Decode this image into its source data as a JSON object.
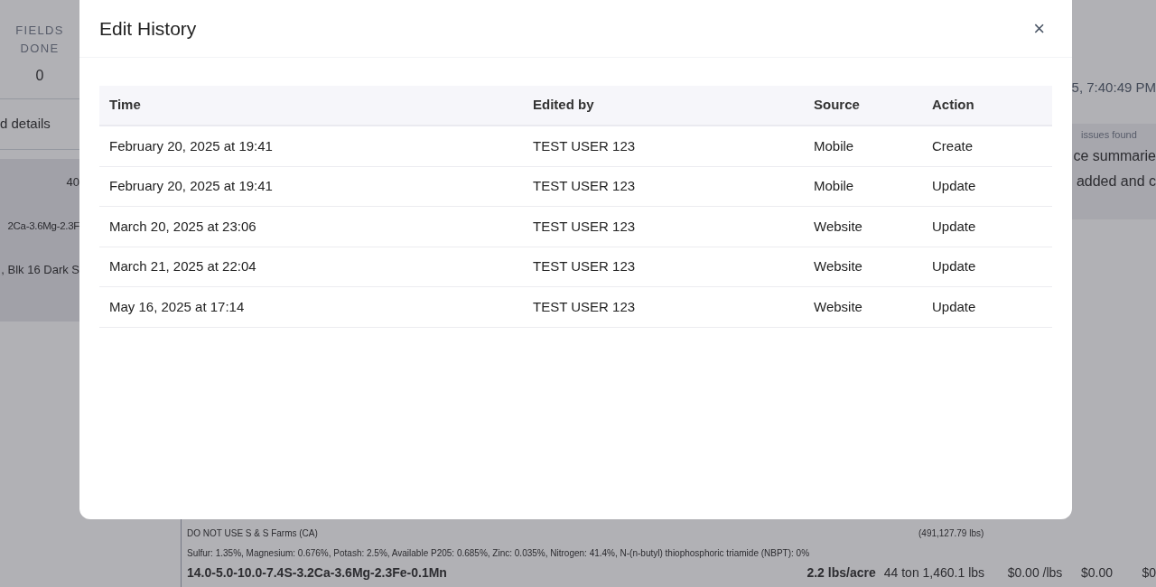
{
  "background": {
    "stat": {
      "label_lines": [
        "FIELDS",
        "DONE"
      ],
      "value": "0"
    },
    "details_link": "d details",
    "left_card": {
      "number": "40",
      "product": "2Ca-3.6Mg-2.3F",
      "location": ", Blk 16 Dark S"
    },
    "right_panel": {
      "timestamp": "5, 7:40:49 PM",
      "issues_label": "issues found",
      "lines": [
        "ce summarie",
        "added and c"
      ]
    },
    "product_row": {
      "source": "DO NOT USE S & S Farms (CA)",
      "total_lbs": "(491,127.79 lbs)",
      "composition": "Sulfur: 1.35%, Magnesium: 0.676%, Potash: 2.5%, Available P205: 0.685%, Zinc: 0.035%, Nitrogen: 41.4%, N-(n-butyl) thiophosphoric triamide (NBPT): 0%",
      "name": "14.0-5.0-10.0-7.4S-3.2Ca-3.6Mg-2.3Fe-0.1Mn",
      "rate": "2.2 lbs/acre",
      "amount": "44 ton 1,460.1 lbs",
      "unit_price": "$0.00 /lbs",
      "cost": "$0.00",
      "cut": "$0"
    }
  },
  "dialog": {
    "title": "Edit History",
    "close": "×",
    "columns": [
      "Time",
      "Edited by",
      "Source",
      "Action"
    ],
    "rows": [
      {
        "time": "February 20, 2025 at 19:41",
        "edited_by": "TEST USER 123",
        "source": "Mobile",
        "action": "Create"
      },
      {
        "time": "February 20, 2025 at 19:41",
        "edited_by": "TEST USER 123",
        "source": "Mobile",
        "action": "Update"
      },
      {
        "time": "March 20, 2025 at 23:06",
        "edited_by": "TEST USER 123",
        "source": "Website",
        "action": "Update"
      },
      {
        "time": "March 21, 2025 at 22:04",
        "edited_by": "TEST USER 123",
        "source": "Website",
        "action": "Update"
      },
      {
        "time": "May 16, 2025 at 17:14",
        "edited_by": "TEST USER 123",
        "source": "Website",
        "action": "Update"
      }
    ]
  }
}
